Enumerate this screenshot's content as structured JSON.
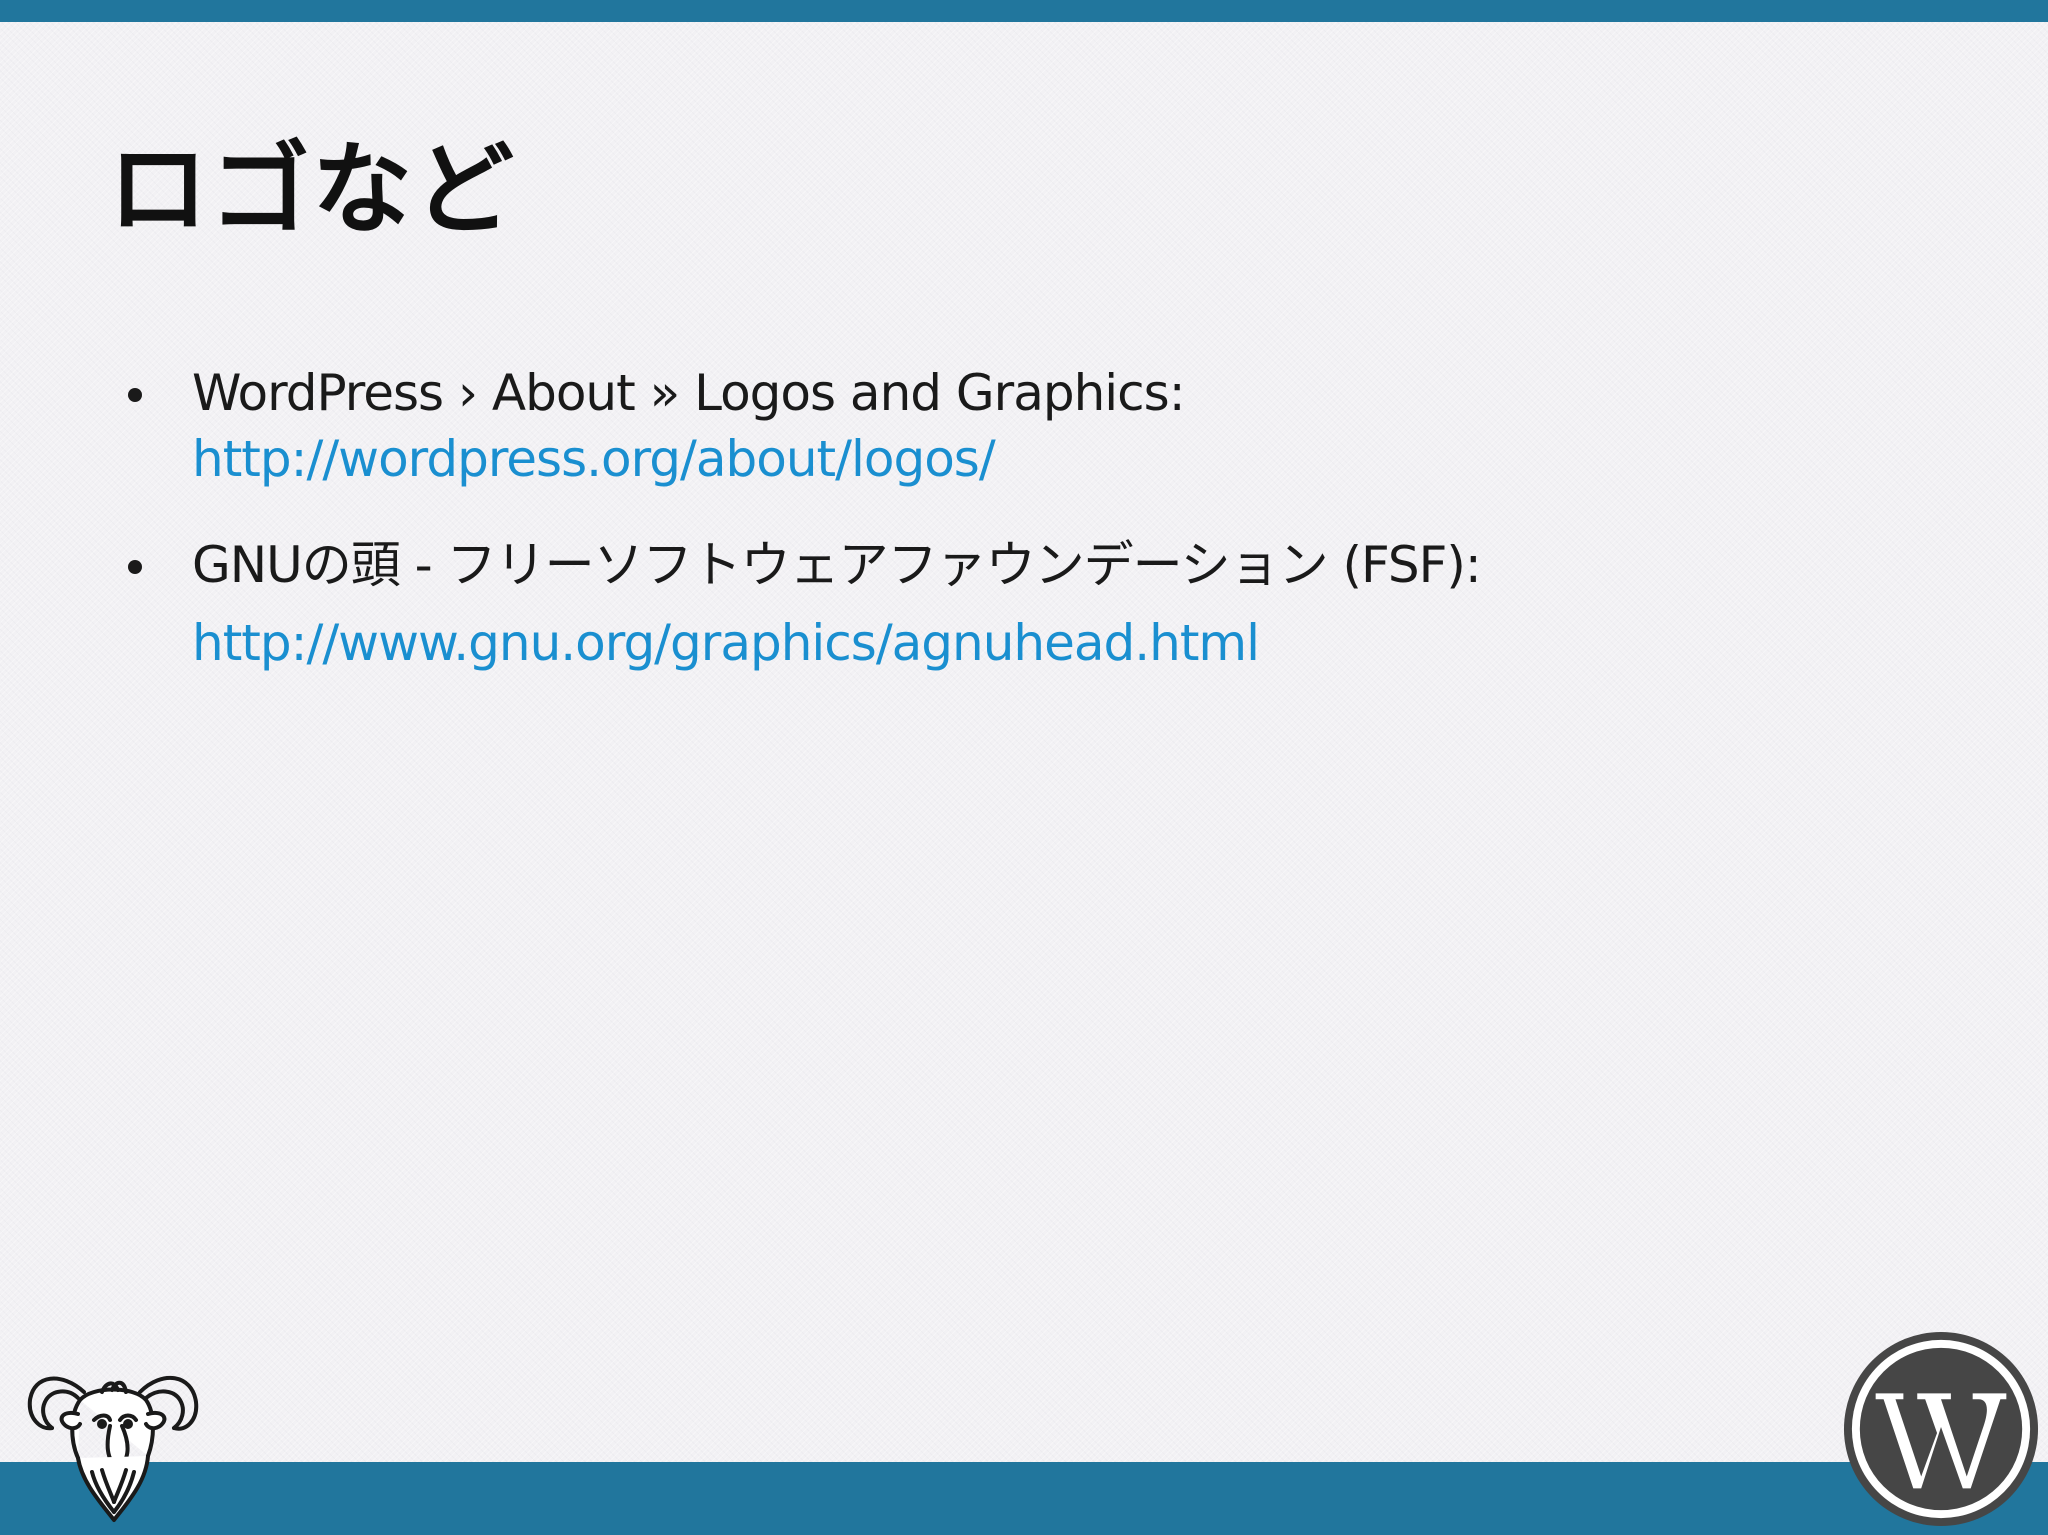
{
  "slide": {
    "title": "ロゴなど",
    "bullets": [
      {
        "text": "WordPress › About » Logos and Graphics:",
        "link": "http://wordpress.org/about/logos/"
      },
      {
        "text": "GNUの頭 - フリーソフトウェアファウンデーション (FSF):",
        "link": "http://www.gnu.org/graphics/agnuhead.html"
      }
    ]
  },
  "theme": {
    "bar_color": "#21769d",
    "link_color": "#1a8fd0",
    "text_color": "#1a1a1a",
    "wp_logo_color": "#464646"
  },
  "icons": {
    "bottom_left": "gnu-head-icon",
    "bottom_right": "wordpress-logo-icon"
  }
}
